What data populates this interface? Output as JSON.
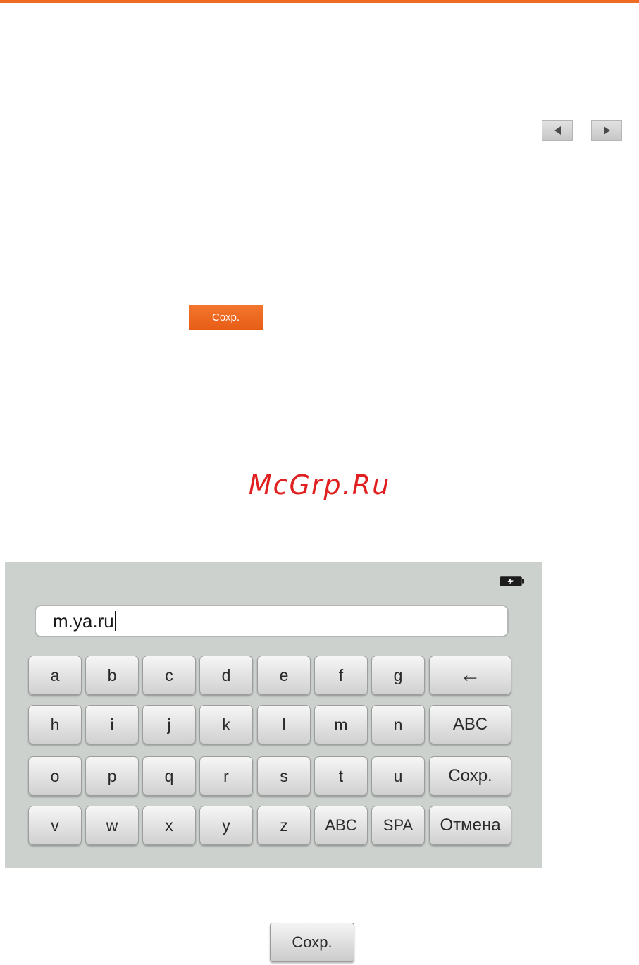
{
  "nav": {
    "prev_icon": "triangle-left-icon",
    "next_icon": "triangle-right-icon"
  },
  "save_button_orange": {
    "label": "Сохр."
  },
  "watermark": {
    "text": "McGrp.Ru"
  },
  "device": {
    "battery_icon": "battery-charging-icon",
    "url_field": {
      "value": "m.ya.ru"
    },
    "keyboard": {
      "row1": [
        "a",
        "b",
        "c",
        "d",
        "e",
        "f",
        "g"
      ],
      "row1_action": "←",
      "row2": [
        "h",
        "i",
        "j",
        "k",
        "l",
        "m",
        "n"
      ],
      "row2_action": "ABC",
      "row3": [
        "o",
        "p",
        "q",
        "r",
        "s",
        "t",
        "u"
      ],
      "row3_action": "Сохр.",
      "row4": [
        "v",
        "w",
        "x",
        "y",
        "z",
        "ABC",
        "SPA"
      ],
      "row4_action": "Отмена"
    }
  },
  "save_button_gray": {
    "label": "Сохр."
  },
  "colors": {
    "accent": "#ef6b24",
    "watermark": "#e02020",
    "panel": "#cdd1ce"
  }
}
